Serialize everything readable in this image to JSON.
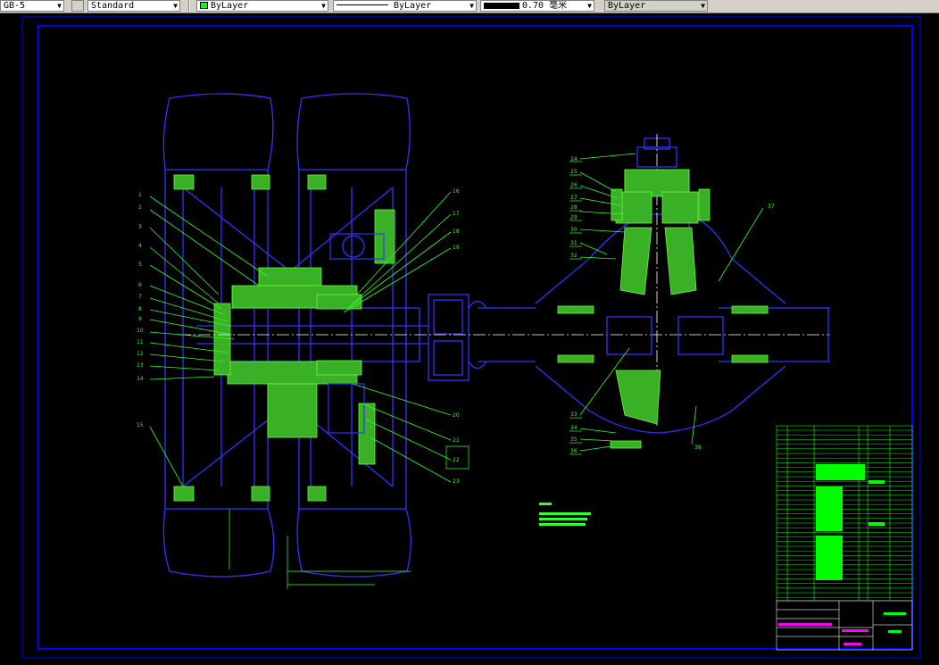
{
  "toolbar": {
    "text_style": "GB-5",
    "dim_style": "Standard",
    "layer_color_name": "ByLayer",
    "layer_color": "#00ff00",
    "linetype": "ByLayer",
    "lineweight": "0.70 毫米",
    "plot_style": "ByLayer"
  },
  "drawing": {
    "balloons_left": [
      "1",
      "2",
      "3",
      "4",
      "5",
      "6",
      "7",
      "8",
      "9",
      "10",
      "11",
      "12",
      "13",
      "14",
      "15"
    ],
    "balloons_mid": [
      "16",
      "17",
      "18",
      "19",
      "20",
      "21",
      "22",
      "23"
    ],
    "balloons_right": [
      "24",
      "25",
      "26",
      "27",
      "28",
      "29",
      "30",
      "31",
      "32",
      "33",
      "34",
      "35",
      "36",
      "37",
      "38"
    ]
  },
  "colors": {
    "frame": "#0000ff",
    "outline": "#3333ff",
    "section": "#66ff33",
    "leader": "#33ff33",
    "highlight": "#ff00ff",
    "table": "#00ff00"
  }
}
